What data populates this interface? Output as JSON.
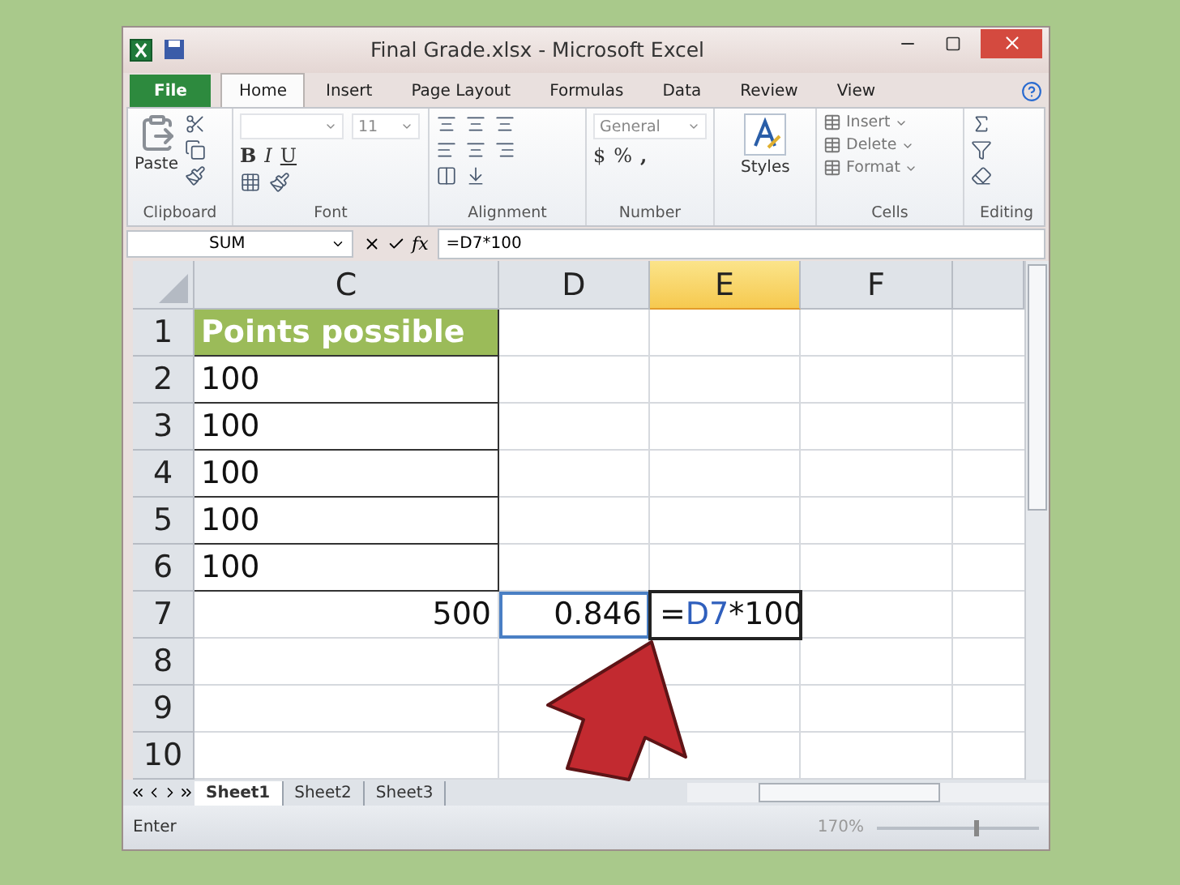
{
  "window": {
    "title": "Final Grade.xlsx  -  Microsoft Excel"
  },
  "ribbon_tabs": [
    {
      "label": "File",
      "kind": "file",
      "selected": false
    },
    {
      "label": "Home",
      "kind": "tab",
      "selected": true
    },
    {
      "label": "Insert",
      "kind": "tab",
      "selected": false
    },
    {
      "label": "Page Layout",
      "kind": "tab",
      "selected": false
    },
    {
      "label": "Formulas",
      "kind": "tab",
      "selected": false
    },
    {
      "label": "Data",
      "kind": "tab",
      "selected": false
    },
    {
      "label": "Review",
      "kind": "tab",
      "selected": false
    },
    {
      "label": "View",
      "kind": "tab",
      "selected": false
    }
  ],
  "ribbon": {
    "paste": "Paste",
    "font_size": "11",
    "bold": "B",
    "italic": "I",
    "underline": "U",
    "number_format": "General",
    "currency": "$",
    "percent": "%",
    "comma": ",",
    "styles": "Styles",
    "cells": [
      "Insert",
      "Delete",
      "Format"
    ],
    "groups": [
      "Clipboard",
      "Font",
      "Alignment",
      "Number",
      "Cells",
      "Editing"
    ]
  },
  "formula_bar": {
    "name_box": "SUM",
    "fx": "fx",
    "formula": "=D7*100"
  },
  "columns": [
    {
      "label": "C",
      "selected": false
    },
    {
      "label": "D",
      "selected": false
    },
    {
      "label": "E",
      "selected": true
    },
    {
      "label": "F",
      "selected": false
    }
  ],
  "rows": [
    {
      "label": "1",
      "c": "Points possible",
      "header": true,
      "total": false
    },
    {
      "label": "2",
      "c": "100",
      "header": false,
      "total": false
    },
    {
      "label": "3",
      "c": "100",
      "header": false,
      "total": false
    },
    {
      "label": "4",
      "c": "100",
      "header": false,
      "total": false
    },
    {
      "label": "5",
      "c": "100",
      "header": false,
      "total": false
    },
    {
      "label": "6",
      "c": "100",
      "header": false,
      "total": false
    },
    {
      "label": "7",
      "c": "500",
      "d": "0.846",
      "header": false,
      "total": true,
      "e": [
        {
          "text": "=",
          "ref": false
        },
        {
          "text": "D7",
          "ref": true
        },
        {
          "text": "*100",
          "ref": false
        }
      ]
    },
    {
      "label": "8"
    },
    {
      "label": "9"
    },
    {
      "label": "10"
    }
  ],
  "sheet_tabs": [
    {
      "label": "Sheet1",
      "selected": true
    },
    {
      "label": "Sheet2",
      "selected": false
    },
    {
      "label": "Sheet3",
      "selected": false
    }
  ],
  "status_bar": {
    "mode": "Enter",
    "zoom": "170%",
    "zoom_slider": {
      "level": 0.6
    }
  }
}
